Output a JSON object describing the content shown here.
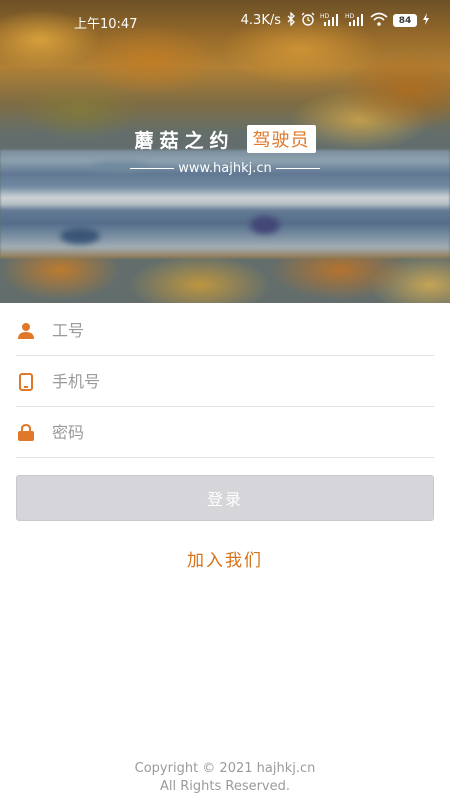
{
  "status_bar": {
    "time": "上午10:47",
    "speed": "4.3K/s",
    "icons": [
      "bluetooth-icon",
      "alarm-icon",
      "signal-hd-icon",
      "signal-hd-icon",
      "wifi-icon",
      "battery-icon",
      "charging-icon"
    ],
    "battery": "84"
  },
  "hero": {
    "brand_name": "蘑菇之约",
    "brand_badge": "驾驶员",
    "website": "www.hajhkj.cn"
  },
  "form": {
    "employee_id": {
      "placeholder": "工号",
      "value": "",
      "icon": "person-icon"
    },
    "phone": {
      "placeholder": "手机号",
      "value": "",
      "icon": "phone-icon"
    },
    "password": {
      "placeholder": "密码",
      "value": "",
      "icon": "lock-icon"
    }
  },
  "actions": {
    "login_label": "登录",
    "join_label": "加入我们"
  },
  "footer": {
    "copyright": "Copyright © 2021 hajhkj.cn",
    "rights": "All Rights Reserved."
  },
  "colors": {
    "accent": "#e0782a",
    "button_disabled": "#d5d5da",
    "footer_text": "#9b9b9b"
  }
}
